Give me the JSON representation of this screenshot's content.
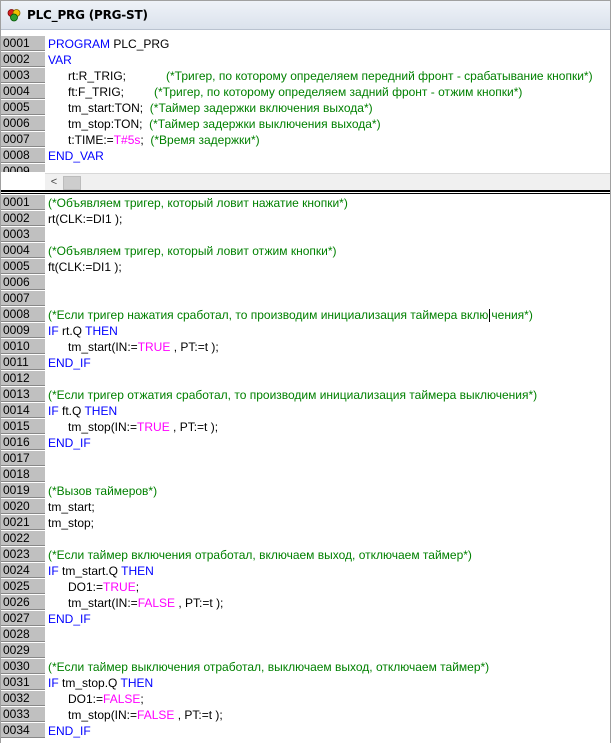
{
  "window": {
    "title": "PLC_PRG (PRG-ST)",
    "icon": "pou-icon"
  },
  "declaration": {
    "lines": [
      {
        "num": "0001",
        "tokens": [
          {
            "t": "kw",
            "v": "PROGRAM"
          },
          {
            "t": "tx",
            "v": " PLC_PRG"
          }
        ]
      },
      {
        "num": "0002",
        "tokens": [
          {
            "t": "kw",
            "v": "VAR"
          }
        ]
      },
      {
        "num": "0003",
        "tokens": [
          {
            "t": "tx",
            "v": "      rt:R_TRIG;            "
          },
          {
            "t": "cm",
            "v": "(*Тригер, по которому определяем передний фронт - срабатывание кнопки*)"
          }
        ]
      },
      {
        "num": "0004",
        "tokens": [
          {
            "t": "tx",
            "v": "      ft:F_TRIG;         "
          },
          {
            "t": "cm",
            "v": "(*Тригер, по которому определяем задний фронт - отжим кнопки*)"
          }
        ]
      },
      {
        "num": "0005",
        "tokens": [
          {
            "t": "tx",
            "v": "      tm_start:TON;  "
          },
          {
            "t": "cm",
            "v": "(*Таймер задержки включения выхода*)"
          }
        ]
      },
      {
        "num": "0006",
        "tokens": [
          {
            "t": "tx",
            "v": "      tm_stop:TON;  "
          },
          {
            "t": "cm",
            "v": "(*Таймер задержки выключения выхода*)"
          }
        ]
      },
      {
        "num": "0007",
        "tokens": [
          {
            "t": "tx",
            "v": "      t:TIME:="
          },
          {
            "t": "lit",
            "v": "T#5s"
          },
          {
            "t": "tx",
            "v": ";  "
          },
          {
            "t": "cm",
            "v": "(*Время задержки*)"
          }
        ]
      },
      {
        "num": "0008",
        "tokens": [
          {
            "t": "kw",
            "v": "END_VAR"
          }
        ]
      },
      {
        "num": "0009",
        "tokens": []
      }
    ]
  },
  "body": {
    "lines": [
      {
        "num": "0001",
        "tokens": [
          {
            "t": "cm",
            "v": "(*Объявляем тригер, который ловит нажатие кнопки*)"
          }
        ]
      },
      {
        "num": "0002",
        "tokens": [
          {
            "t": "tx",
            "v": "rt(CLK:=DI1 );"
          }
        ]
      },
      {
        "num": "0003",
        "tokens": []
      },
      {
        "num": "0004",
        "tokens": [
          {
            "t": "cm",
            "v": "(*Объявляем тригер, который ловит отжим кнопки*)"
          }
        ]
      },
      {
        "num": "0005",
        "tokens": [
          {
            "t": "tx",
            "v": "ft(CLK:=DI1 );"
          }
        ]
      },
      {
        "num": "0006",
        "tokens": []
      },
      {
        "num": "0007",
        "tokens": []
      },
      {
        "num": "0008",
        "tokens": [
          {
            "t": "cm",
            "v": "(*Если тригер нажатия сработал, то производим инициализация таймера вклю"
          },
          {
            "t": "cursor",
            "v": ""
          },
          {
            "t": "cm",
            "v": "чения*)"
          }
        ]
      },
      {
        "num": "0009",
        "tokens": [
          {
            "t": "kw",
            "v": "IF"
          },
          {
            "t": "tx",
            "v": " rt.Q "
          },
          {
            "t": "kw",
            "v": "THEN"
          }
        ]
      },
      {
        "num": "0010",
        "tokens": [
          {
            "t": "tx",
            "v": "      tm_start(IN:="
          },
          {
            "t": "lit",
            "v": "TRUE"
          },
          {
            "t": "tx",
            "v": " , PT:=t );"
          }
        ]
      },
      {
        "num": "0011",
        "tokens": [
          {
            "t": "kw",
            "v": "END_IF"
          }
        ]
      },
      {
        "num": "0012",
        "tokens": []
      },
      {
        "num": "0013",
        "tokens": [
          {
            "t": "cm",
            "v": "(*Если тригер отжатия сработал, то производим инициализация таймера выключения*)"
          }
        ]
      },
      {
        "num": "0014",
        "tokens": [
          {
            "t": "kw",
            "v": "IF"
          },
          {
            "t": "tx",
            "v": " ft.Q "
          },
          {
            "t": "kw",
            "v": "THEN"
          }
        ]
      },
      {
        "num": "0015",
        "tokens": [
          {
            "t": "tx",
            "v": "      tm_stop(IN:="
          },
          {
            "t": "lit",
            "v": "TRUE"
          },
          {
            "t": "tx",
            "v": " , PT:=t );"
          }
        ]
      },
      {
        "num": "0016",
        "tokens": [
          {
            "t": "kw",
            "v": "END_IF"
          }
        ]
      },
      {
        "num": "0017",
        "tokens": []
      },
      {
        "num": "0018",
        "tokens": []
      },
      {
        "num": "0019",
        "tokens": [
          {
            "t": "cm",
            "v": "(*Вызов таймеров*)"
          }
        ]
      },
      {
        "num": "0020",
        "tokens": [
          {
            "t": "tx",
            "v": "tm_start;"
          }
        ]
      },
      {
        "num": "0021",
        "tokens": [
          {
            "t": "tx",
            "v": "tm_stop;"
          }
        ]
      },
      {
        "num": "0022",
        "tokens": []
      },
      {
        "num": "0023",
        "tokens": [
          {
            "t": "cm",
            "v": "(*Если таймер включения отработал, включаем выход, отключаем таймер*)"
          }
        ]
      },
      {
        "num": "0024",
        "tokens": [
          {
            "t": "kw",
            "v": "IF"
          },
          {
            "t": "tx",
            "v": " tm_start.Q "
          },
          {
            "t": "kw",
            "v": "THEN"
          }
        ]
      },
      {
        "num": "0025",
        "tokens": [
          {
            "t": "tx",
            "v": "      DO1:="
          },
          {
            "t": "lit",
            "v": "TRUE"
          },
          {
            "t": "tx",
            "v": ";"
          }
        ]
      },
      {
        "num": "0026",
        "tokens": [
          {
            "t": "tx",
            "v": "      tm_start(IN:="
          },
          {
            "t": "lit",
            "v": "FALSE"
          },
          {
            "t": "tx",
            "v": " , PT:=t );"
          }
        ]
      },
      {
        "num": "0027",
        "tokens": [
          {
            "t": "kw",
            "v": "END_IF"
          }
        ]
      },
      {
        "num": "0028",
        "tokens": []
      },
      {
        "num": "0029",
        "tokens": []
      },
      {
        "num": "0030",
        "tokens": [
          {
            "t": "cm",
            "v": "(*Если таймер выключения отработал, выключаем выход, отключаем таймер*)"
          }
        ]
      },
      {
        "num": "0031",
        "tokens": [
          {
            "t": "kw",
            "v": "IF"
          },
          {
            "t": "tx",
            "v": " tm_stop.Q "
          },
          {
            "t": "kw",
            "v": "THEN"
          }
        ]
      },
      {
        "num": "0032",
        "tokens": [
          {
            "t": "tx",
            "v": "      DO1:="
          },
          {
            "t": "lit",
            "v": "FALSE"
          },
          {
            "t": "tx",
            "v": ";"
          }
        ]
      },
      {
        "num": "0033",
        "tokens": [
          {
            "t": "tx",
            "v": "      tm_stop(IN:="
          },
          {
            "t": "lit",
            "v": "FALSE"
          },
          {
            "t": "tx",
            "v": " , PT:=t );"
          }
        ]
      },
      {
        "num": "0034",
        "tokens": [
          {
            "t": "kw",
            "v": "END_IF"
          }
        ]
      }
    ]
  },
  "scrollbar": {
    "left_arrow": "<"
  },
  "colors": {
    "keyword": "#0000ff",
    "comment": "#008000",
    "literal": "#ff00ff",
    "line_number_bg": "#c0c0c0"
  }
}
